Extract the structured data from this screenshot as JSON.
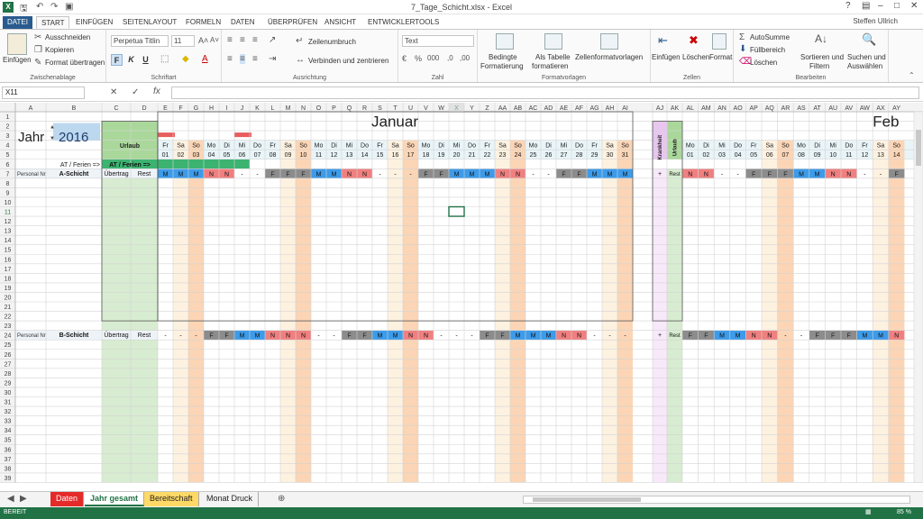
{
  "window": {
    "title": "7_Tage_Schicht.xlsx - Excel",
    "user": "Steffen Ullrich"
  },
  "tabs": [
    "DATEI",
    "START",
    "EINFÜGEN",
    "SEITENLAYOUT",
    "FORMELN",
    "DATEN",
    "ÜBERPRÜFEN",
    "ANSICHT",
    "ENTWICKLERTOOLS"
  ],
  "ribbon": {
    "clipboard": {
      "paste": "Einfügen",
      "cut": "Ausschneiden",
      "copy": "Kopieren",
      "painter": "Format übertragen",
      "label": "Zwischenablage"
    },
    "font": {
      "name": "Perpetua Titlin",
      "size": "11",
      "bold": "F",
      "italic": "K",
      "underline": "U",
      "label": "Schriftart"
    },
    "align": {
      "wrap": "Zeilenumbruch",
      "merge": "Verbinden und zentrieren",
      "label": "Ausrichtung"
    },
    "number": {
      "format": "Text",
      "label": "Zahl"
    },
    "styles": {
      "cond1": "Bedingte",
      "cond2": "Formatierung",
      "table1": "Als Tabelle",
      "table2": "formatieren",
      "cell": "Zellenformatvorlagen",
      "label": "Formatvorlagen"
    },
    "cells": {
      "insert": "Einfügen",
      "delete": "Löschen",
      "format": "Format",
      "label": "Zellen"
    },
    "edit": {
      "autosum": "AutoSumme",
      "fill": "Füllbereich",
      "clear": "Löschen",
      "sort1": "Sortieren und",
      "sort2": "Filtern",
      "find1": "Suchen und",
      "find2": "Auswählen",
      "label": "Bearbeiten"
    }
  },
  "formula": {
    "cell": "X11",
    "fx": "fx",
    "value": ""
  },
  "columns": [
    "A",
    "B",
    "C",
    "D",
    "E",
    "F",
    "G",
    "H",
    "I",
    "J",
    "K",
    "L",
    "M",
    "N",
    "O",
    "P",
    "Q",
    "R",
    "S",
    "T",
    "U",
    "V",
    "W",
    "X",
    "Y",
    "Z",
    "AA",
    "AB",
    "AC",
    "AD",
    "AE",
    "AF",
    "AG",
    "AH",
    "AI",
    "AJ",
    "AK",
    "AL",
    "AM",
    "AN",
    "AO",
    "AP",
    "AQ",
    "AR",
    "AS",
    "AT",
    "AU",
    "AV",
    "AW",
    "AX",
    "AY"
  ],
  "sheet": {
    "jahr_label": "Jahr",
    "year": "2016",
    "urlaub": "Urlaub",
    "month1": "Januar",
    "month2": "Feb",
    "at_ferien": "AT / Ferien =>",
    "krankheit": "Krankheit",
    "urlaub_v": "Urlaub",
    "a_schicht": "A-Schicht",
    "b_schicht": "B-Schicht",
    "personal": "Personal Nr",
    "uebertrag": "Übertrag",
    "rest": "Rest",
    "plus": "+",
    "jan_days": [
      "Fr",
      "Sa",
      "So",
      "Mo",
      "Di",
      "Mi",
      "Do",
      "Fr",
      "Sa",
      "So",
      "Mo",
      "Di",
      "Mi",
      "Do",
      "Fr",
      "Sa",
      "So",
      "Mo",
      "Di",
      "Mi",
      "Do",
      "Fr",
      "Sa",
      "So",
      "Mo",
      "Di",
      "Mi",
      "Do",
      "Fr",
      "Sa",
      "So"
    ],
    "jan_nums": [
      "01",
      "02",
      "03",
      "04",
      "05",
      "06",
      "07",
      "08",
      "09",
      "10",
      "11",
      "12",
      "13",
      "14",
      "15",
      "16",
      "17",
      "18",
      "19",
      "20",
      "21",
      "22",
      "23",
      "24",
      "25",
      "26",
      "27",
      "28",
      "29",
      "30",
      "31"
    ],
    "feb_days": [
      "Mo",
      "Di",
      "Mi",
      "Do",
      "Fr",
      "Sa",
      "So",
      "Mo",
      "Di",
      "Mi",
      "Do",
      "Fr",
      "Sa",
      "So"
    ],
    "feb_nums": [
      "01",
      "02",
      "03",
      "04",
      "05",
      "06",
      "07",
      "08",
      "09",
      "10",
      "11",
      "12",
      "13",
      "14"
    ],
    "a_jan": [
      "M",
      "M",
      "M",
      "N",
      "N",
      "-",
      "-",
      "F",
      "F",
      "F",
      "M",
      "M",
      "N",
      "N",
      "-",
      "-",
      "-",
      "F",
      "F",
      "M",
      "M",
      "M",
      "N",
      "N",
      "-",
      "-",
      "F",
      "F",
      "M",
      "M",
      "M"
    ],
    "a_feb": [
      "N",
      "N",
      "-",
      "-",
      "F",
      "F",
      "F",
      "M",
      "M",
      "N",
      "N",
      "-",
      "-",
      "F"
    ],
    "b_jan": [
      "-",
      "-",
      "-",
      "F",
      "F",
      "M",
      "M",
      "N",
      "N",
      "N",
      "-",
      "-",
      "F",
      "F",
      "M",
      "M",
      "N",
      "N",
      "-",
      "-",
      "-",
      "F",
      "F",
      "M",
      "M",
      "M",
      "N",
      "N",
      "-",
      "-",
      "-"
    ],
    "b_feb": [
      "F",
      "F",
      "M",
      "M",
      "N",
      "N",
      "-",
      "-",
      "F",
      "F",
      "F",
      "M",
      "M",
      "N"
    ],
    "rows": [
      "1",
      "2",
      "3",
      "4",
      "5",
      "6",
      "7",
      "8",
      "9",
      "10",
      "11",
      "12",
      "13",
      "14",
      "15",
      "16",
      "17",
      "18",
      "19",
      "20",
      "21",
      "22",
      "23",
      "24",
      "25",
      "26",
      "27",
      "28",
      "29",
      "30",
      "31",
      "32",
      "33",
      "34",
      "35",
      "36",
      "37",
      "38",
      "39"
    ]
  },
  "sheets": [
    "Daten",
    "Jahr gesamt",
    "Bereitschaft",
    "Monat Druck"
  ],
  "status": {
    "mode": "BEREIT",
    "zoom": "85 %"
  },
  "colors": {
    "M": "#3d9be9",
    "N": "#f08080",
    "F": "#8c8c8c",
    "weekend": "#fbd5b5",
    "sat": "#fdf1e0",
    "urlaub": "#a9d89a",
    "krank": "#e8c6f0",
    "header": "#e8f4f8",
    "excel": "#217346"
  }
}
